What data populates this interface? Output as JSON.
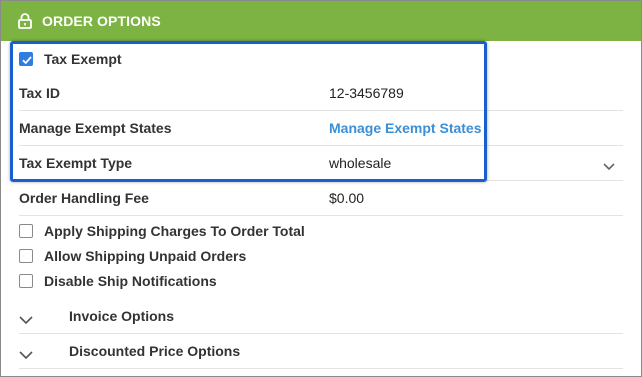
{
  "header": {
    "title": "ORDER OPTIONS",
    "icon": "lock-icon",
    "color": "#7cb342"
  },
  "tax_exempt": {
    "label": "Tax Exempt",
    "checked": true
  },
  "tax_id": {
    "label": "Tax ID",
    "value": "12-3456789"
  },
  "manage_exempt_states": {
    "label": "Manage Exempt States",
    "link_text": "Manage Exempt States"
  },
  "tax_exempt_type": {
    "label": "Tax Exempt Type",
    "value": "wholesale"
  },
  "order_handling_fee": {
    "label": "Order Handling Fee",
    "value": "$0.00"
  },
  "checkboxes": [
    {
      "label": "Apply Shipping Charges To Order Total",
      "checked": false
    },
    {
      "label": "Allow Shipping Unpaid Orders",
      "checked": false
    },
    {
      "label": "Disable Ship Notifications",
      "checked": false
    }
  ],
  "sections": [
    {
      "label": "Invoice Options"
    },
    {
      "label": "Discounted Price Options"
    }
  ],
  "colors": {
    "accent": "#2f7de1",
    "link": "#3a8fd6",
    "highlight_border": "#1a5fd0"
  }
}
